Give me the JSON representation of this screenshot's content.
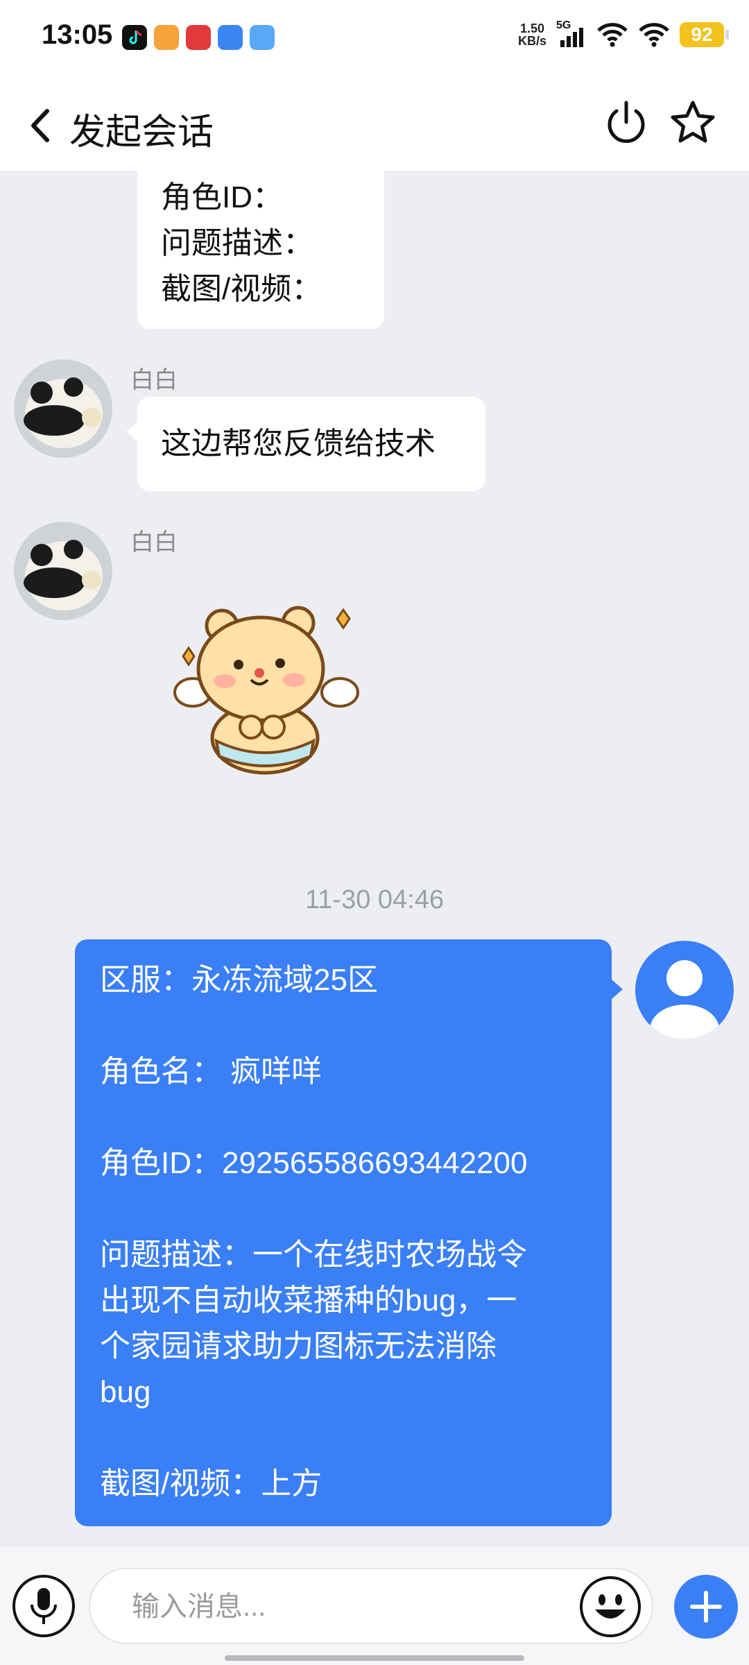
{
  "status_bar": {
    "time": "13:05",
    "net_speed_value": "1.50",
    "net_speed_unit": "KB/s",
    "network_type": "5G",
    "battery": "92",
    "app_icons": [
      "douyin-icon",
      "app-orange-icon",
      "app-red-icon",
      "app-blue-icon",
      "app-file-icon"
    ]
  },
  "header": {
    "title": "发起会话",
    "back_icon": "chevron-left-icon",
    "power_icon": "power-icon",
    "star_icon": "star-outline-icon"
  },
  "chat": {
    "template_bubble": {
      "lines": [
        "角色ID：",
        "问题描述：",
        "截图/视频："
      ]
    },
    "agent_message_1": {
      "sender": "白白",
      "text": "这边帮您反馈给技术"
    },
    "agent_message_2": {
      "sender": "白白",
      "sticker": "bear-sticker"
    },
    "timestamp": "11-30 04:46",
    "user_message": {
      "server": "区服：永冻流域25区",
      "role_name": "角色名： 疯咩咩",
      "role_id": "角色ID：2925655866934422​00",
      "description_line1": "问题描述：一个在线时农场战令",
      "description_line2": "出现不自动收菜播种的bug，一",
      "description_line3": "个家园请求助力图标无法消除",
      "description_line4": "bug",
      "screenshot": "截图/视频：上方"
    }
  },
  "input_bar": {
    "placeholder": "输入消息...",
    "mic_icon": "microphone-icon",
    "emoji_icon": "smiley-icon",
    "plus_icon": "plus-icon"
  },
  "colors": {
    "accent": "#3a7ff6",
    "background": "#edeef2",
    "battery": "#f3c21c"
  }
}
